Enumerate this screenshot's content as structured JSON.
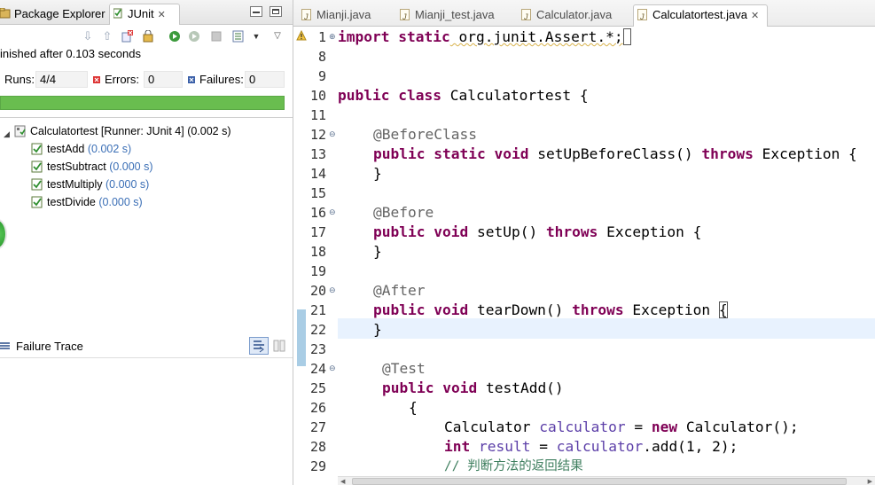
{
  "left_panel": {
    "tabs": [
      {
        "label": "Package Explorer",
        "icon": "package-explorer-icon"
      },
      {
        "label": "JUnit",
        "icon": "junit-icon",
        "active": true
      }
    ],
    "status": "inished after 0.103 seconds",
    "counters": {
      "runs_label": "Runs:",
      "runs_value": "4/4",
      "errors_label": "Errors:",
      "errors_value": "0",
      "failures_label": "Failures:",
      "failures_value": "0"
    },
    "progress_fraction": 1.0,
    "progress_color": "#69bd4f",
    "tree": {
      "root": {
        "label": "Calculatortest [Runner: JUnit 4]",
        "time": "(0.002 s)"
      },
      "children": [
        {
          "label": "testAdd",
          "time": "(0.002 s)"
        },
        {
          "label": "testSubtract",
          "time": "(0.000 s)"
        },
        {
          "label": "testMultiply",
          "time": "(0.000 s)"
        },
        {
          "label": "testDivide",
          "time": "(0.000 s)"
        }
      ]
    },
    "failure_trace_label": "Failure Trace"
  },
  "editor": {
    "tabs": [
      {
        "label": "Mianji.java"
      },
      {
        "label": "Mianji_test.java"
      },
      {
        "label": "Calculator.java"
      },
      {
        "label": "Calculatortest.java",
        "active": true
      }
    ],
    "line_numbers": [
      "1",
      "8",
      "9",
      "10",
      "11",
      "12",
      "13",
      "14",
      "15",
      "16",
      "17",
      "18",
      "19",
      "20",
      "21",
      "22",
      "23",
      "24",
      "25",
      "26",
      "27",
      "28",
      "29"
    ],
    "code_text": {
      "l1_kw1": "import",
      "l1_kw2": "static",
      "l1_rest": " org.junit.Assert.*;",
      "l10_kw1": "public",
      "l10_kw2": "class",
      "l10_rest": " Calculatortest {",
      "l12_ann": "@BeforeClass",
      "l13_kw1": "public",
      "l13_kw2": "static",
      "l13_kw3": "void",
      "l13_mid": " setUpBeforeClass() ",
      "l13_kw4": "throws",
      "l13_rest": " Exception {",
      "brace_close": "}",
      "l16_ann": "@Before",
      "l17_kw1": "public",
      "l17_kw2": "void",
      "l17_mid": " setUp() ",
      "l17_kw3": "throws",
      "l17_rest": " Exception {",
      "l20_ann": "@After",
      "l21_kw1": "public",
      "l21_kw2": "void",
      "l21_mid": " tearDown() ",
      "l21_kw3": "throws",
      "l21_rest": " Exception ",
      "l21_brace": "{",
      "l24_ann": "@Test",
      "l25_kw1": "public",
      "l25_kw2": "void",
      "l25_rest": " testAdd()",
      "brace_open": "{",
      "l27_a": "Calculator ",
      "l27_fld": "calculator",
      "l27_b": " = ",
      "l27_kw": "new",
      "l27_c": " Calculator();",
      "l28_kw": "int",
      "l28_fld1": "result",
      "l28_eq": " = ",
      "l28_fld2": "calculator",
      "l28_rest": ".add(1, 2);",
      "l29_cmt": "// 判断方法的返回结果"
    },
    "colors": {
      "keyword": "#7f0055",
      "annotation": "#646464",
      "field": "#5c3fa8",
      "comment": "#3f7f5f",
      "current_line": "#e8f2fe"
    }
  }
}
